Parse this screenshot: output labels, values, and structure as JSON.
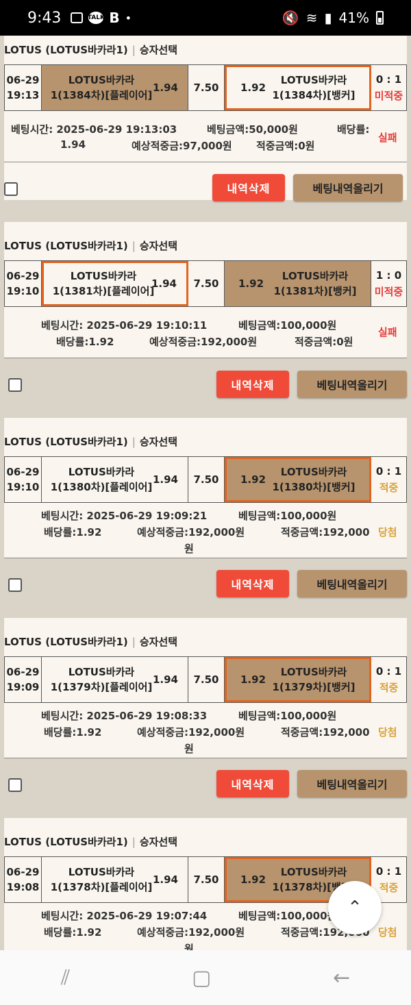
{
  "status_bar": {
    "time": "9:43",
    "battery": "41%"
  },
  "cards": [
    {
      "title": "LOTUS (LOTUS바카라1)",
      "bet_type": "승자선택",
      "date": "06-29",
      "clock": "19:13",
      "home": "LOTUS바카라1(1384차)[플레이어]",
      "home_odd": "1.94",
      "draw": "7.50",
      "away": "LOTUS바카라1(1384차)[뱅커]",
      "away_odd": "1.92",
      "score": "0 : 1",
      "status": "미적중",
      "bet_time": "베팅시간: 2025-06-29 19:13:03",
      "bet_amount": "베팅금액:50,000원",
      "odds_label": "배당률:",
      "odds_value": "1.94",
      "expected": "예상적중금:97,000원",
      "won": "적중금액:0원",
      "result": "실패"
    },
    {
      "title": "LOTUS (LOTUS바카라1)",
      "bet_type": "승자선택",
      "date": "06-29",
      "clock": "19:10",
      "home": "LOTUS바카라1(1381차)[플레이어]",
      "home_odd": "1.94",
      "draw": "7.50",
      "away": "LOTUS바카라1(1381차)[뱅커]",
      "away_odd": "1.92",
      "score": "1 : 0",
      "status": "미적중",
      "bet_time": "베팅시간: 2025-06-29 19:10:11",
      "bet_amount": "베팅금액:100,000원",
      "odds": "배당률:1.92",
      "expected": "예상적중금:192,000원",
      "won": "적중금액:0원",
      "result": "실패"
    },
    {
      "title": "LOTUS (LOTUS바카라1)",
      "bet_type": "승자선택",
      "date": "06-29",
      "clock": "19:10",
      "home": "LOTUS바카라1(1380차)[플레이어]",
      "home_odd": "1.94",
      "draw": "7.50",
      "away": "LOTUS바카라1(1380차)[뱅커]",
      "away_odd": "1.92",
      "score": "0 : 1",
      "status": "적중",
      "bet_time": "베팅시간: 2025-06-29 19:09:21",
      "bet_amount": "베팅금액:100,000원",
      "odds": "배당률:1.92",
      "expected": "예상적중금:192,000원",
      "won": "적중금액:192,000",
      "won_unit": "원",
      "result": "당첨"
    },
    {
      "title": "LOTUS (LOTUS바카라1)",
      "bet_type": "승자선택",
      "date": "06-29",
      "clock": "19:09",
      "home": "LOTUS바카라1(1379차)[플레이어]",
      "home_odd": "1.94",
      "draw": "7.50",
      "away": "LOTUS바카라1(1379차)[뱅커]",
      "away_odd": "1.92",
      "score": "0 : 1",
      "status": "적중",
      "bet_time": "베팅시간: 2025-06-29 19:08:33",
      "bet_amount": "베팅금액:100,000원",
      "odds": "배당률:1.92",
      "expected": "예상적중금:192,000원",
      "won": "적중금액:192,000",
      "won_unit": "원",
      "result": "당첨"
    },
    {
      "title": "LOTUS (LOTUS바카라1)",
      "bet_type": "승자선택",
      "date": "06-29",
      "clock": "19:08",
      "home": "LOTUS바카라1(1378차)[플레이어]",
      "home_odd": "1.94",
      "draw": "7.50",
      "away": "LOTUS바카라1(1378차)[뱅커]",
      "away_odd": "1.92",
      "score": "0 : 1",
      "status": "적중",
      "bet_time": "베팅시간: 2025-06-29 19:07:44",
      "bet_amount": "베팅금액:100,000원",
      "odds": "배당률:1.92",
      "expected": "예상적중금:192,000원",
      "won": "적중금액:192,000",
      "won_unit": "원",
      "result": "당첨"
    }
  ],
  "buttons": {
    "delete": "내역삭제",
    "upload": "베팅내역올리기"
  },
  "colors": {
    "accent_tan": "#b7946e",
    "delete_red": "#f04a38",
    "selected_border": "#e2631d",
    "fail_red": "#e53b3b",
    "win_gold": "#d9a23a"
  }
}
